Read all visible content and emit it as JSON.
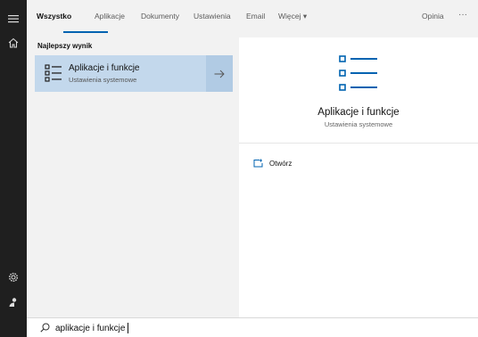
{
  "tabs": [
    {
      "label": "Wszystko"
    },
    {
      "label": "Aplikacje"
    },
    {
      "label": "Dokumenty"
    },
    {
      "label": "Ustawienia"
    },
    {
      "label": "Email"
    },
    {
      "label": "Więcej ▾"
    }
  ],
  "feedback_label": "Opinia",
  "more_label": "···",
  "best_match": {
    "section_title": "Najlepszy wynik",
    "title": "Aplikacje i funkcje",
    "subtitle": "Ustawienia systemowe"
  },
  "preview": {
    "title": "Aplikacje i funkcje",
    "subtitle": "Ustawienia systemowe",
    "open_label": "Otwórz"
  },
  "search": {
    "value": "aplikacje i funkcje"
  },
  "colors": {
    "accent": "#0063b1",
    "selected_row": "#c3d8ec",
    "rail": "#1f1f1f"
  },
  "icons": {
    "rail": [
      "hamburger-icon",
      "home-icon",
      "gear-icon",
      "user-icon"
    ],
    "result": "apps-list-icon",
    "open": "open-window-icon",
    "search": "search-icon",
    "arrow": "arrow-right-icon"
  }
}
